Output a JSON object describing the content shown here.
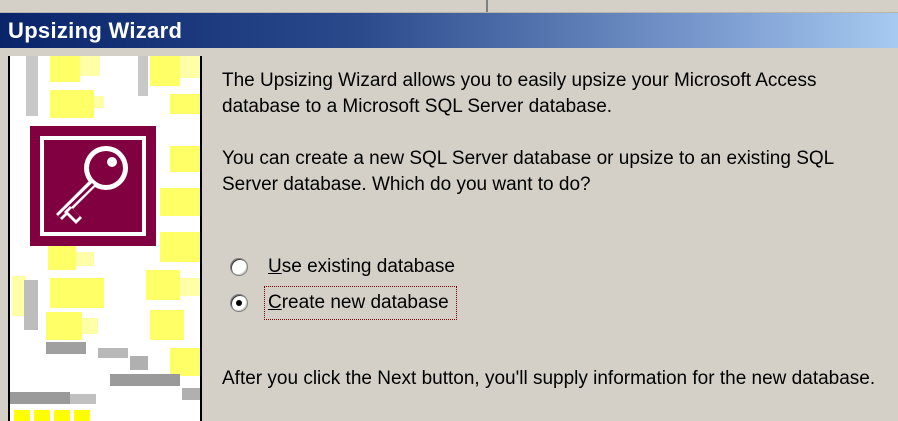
{
  "window": {
    "title": "Upsizing Wizard"
  },
  "content": {
    "intro": "The Upsizing Wizard allows you to easily upsize your Microsoft Access database to a Microsoft SQL Server database.",
    "question": "You can create a new SQL Server database or upsize to an existing SQL Server database. Which do you want to do?",
    "footer": "After you click the Next button, you'll supply information for the new database."
  },
  "options": [
    {
      "label_first": "U",
      "label_rest": "se existing database",
      "selected": false
    },
    {
      "label_first": "C",
      "label_rest": "reate new database",
      "selected": true
    }
  ],
  "icons": {
    "access_key": "access-key-icon"
  },
  "colors": {
    "titlebar_start": "#0a246a",
    "titlebar_end": "#a6caf0",
    "dialog_bg": "#d4d0c8",
    "access_icon": "#800040",
    "graphic_yellow": "#ffff66"
  }
}
